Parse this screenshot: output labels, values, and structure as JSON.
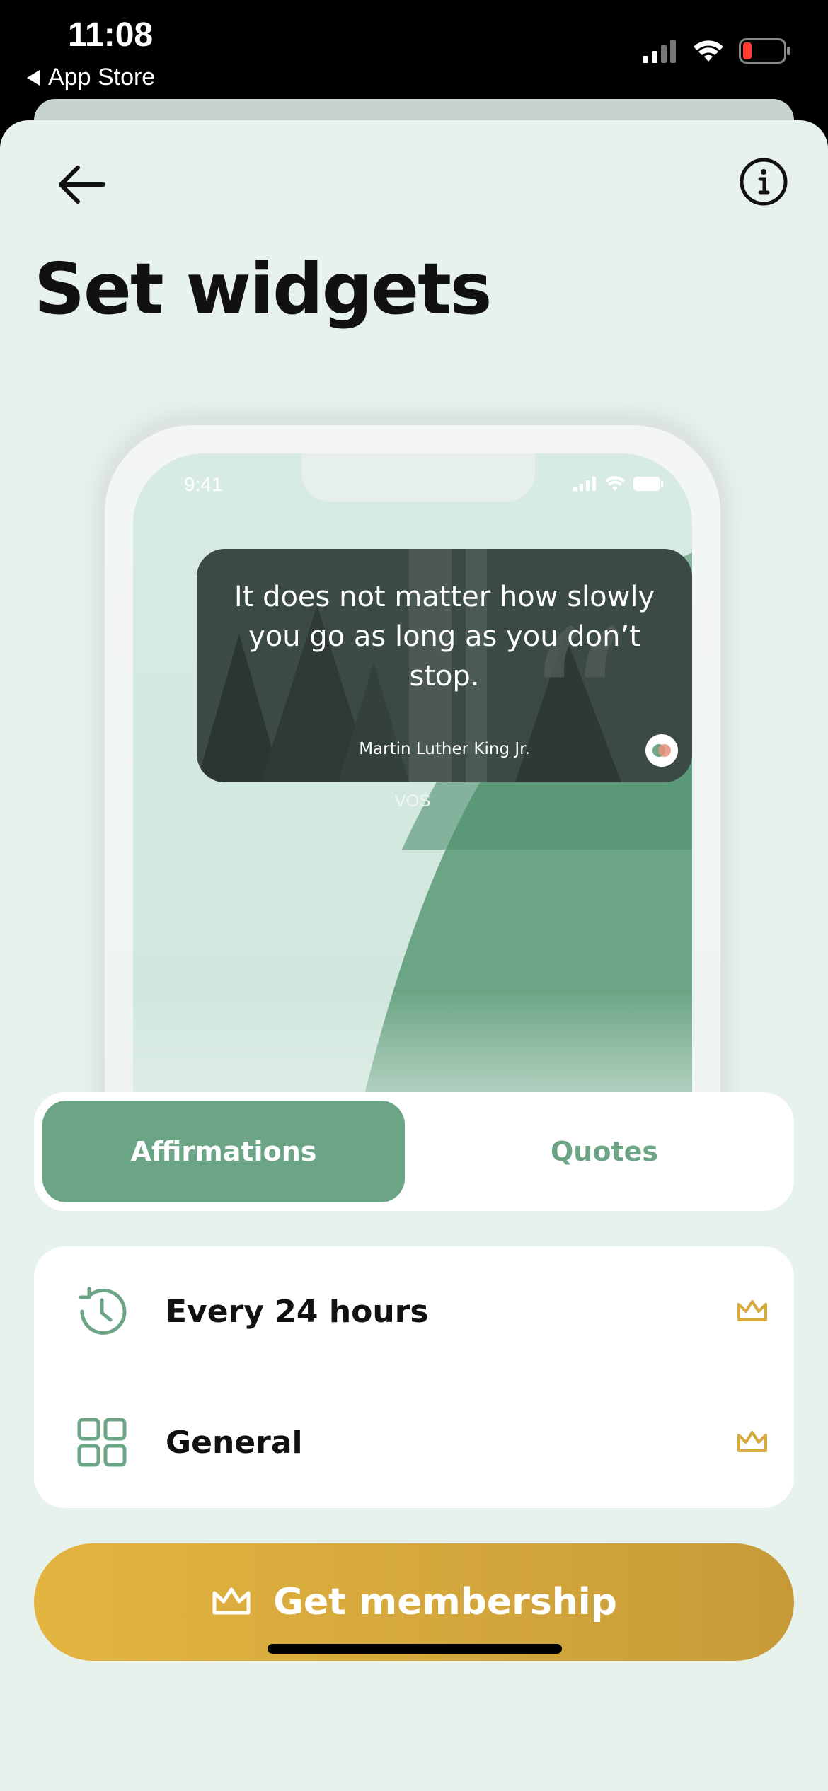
{
  "status_bar": {
    "time": "11:08",
    "back_app": "App Store"
  },
  "header": {
    "title": "Set widgets",
    "back_icon": "arrow-left-icon",
    "info_icon": "info-icon"
  },
  "preview": {
    "phone_time": "9:41",
    "quote": "It does not matter how slowly you go as long as you don’t stop.",
    "author": "Martin Luther King Jr.",
    "app_label": "VOS"
  },
  "segmented": {
    "active": "Affirmations",
    "inactive": "Quotes"
  },
  "options": [
    {
      "label": "Every 24 hours",
      "icon": "clock-refresh-icon",
      "premium_icon": "crown-icon"
    },
    {
      "label": "General",
      "icon": "grid-icon",
      "premium_icon": "crown-icon"
    }
  ],
  "cta": {
    "label": "Get membership",
    "icon": "crown-icon"
  },
  "colors": {
    "background": "#e7f2ed",
    "accent_green": "#6ca585",
    "gold": "#d6a93d"
  }
}
